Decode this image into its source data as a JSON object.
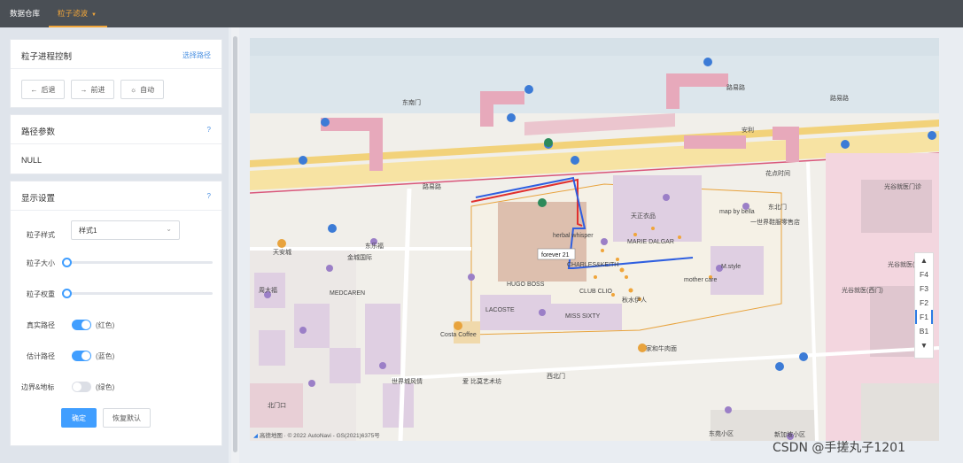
{
  "nav": {
    "item1": "数据仓库",
    "item2": "粒子滤波"
  },
  "control": {
    "title": "粒子进程控制",
    "link": "选择路径",
    "back": "后退",
    "forward": "前进",
    "auto": "自动"
  },
  "path": {
    "title": "路径参数",
    "help": "?",
    "value": "NULL"
  },
  "display": {
    "title": "显示设置",
    "help": "?",
    "style_label": "粒子样式",
    "style_value": "样式1",
    "size_label": "粒子大小",
    "size_value": 0,
    "weight_label": "粒子权重",
    "weight_value": 0,
    "true_label": "真实路径",
    "true_note": "(红色)",
    "true_on": true,
    "est_label": "估计路径",
    "est_note": "(蓝色)",
    "est_on": true,
    "border_label": "边界&地标",
    "border_note": "(绿色)",
    "border_on": false,
    "confirm": "确定",
    "reset": "恢复默认"
  },
  "map": {
    "floors": [
      "F4",
      "F3",
      "F2",
      "F1",
      "B1"
    ],
    "selected_floor": "F1",
    "tooltip": "forever 21",
    "attribution": "高德地图 · © 2022 AutoNavi - GS(2021)6375号",
    "labels": [
      {
        "t": "东南门"
      },
      {
        "t": "路易路"
      },
      {
        "t": "路易路"
      },
      {
        "t": "路易路"
      },
      {
        "t": "安利"
      },
      {
        "t": "花点时间"
      },
      {
        "t": "光谷就医门诊"
      },
      {
        "t": "光谷就医(西门)"
      },
      {
        "t": "光谷就医(西门)"
      },
      {
        "t": "天正衣品"
      },
      {
        "t": "map by bella"
      },
      {
        "t": "一世界鞋服零售店"
      },
      {
        "t": "MARIE DALGAR"
      },
      {
        "t": "herbal whisper"
      },
      {
        "t": "CHARLES&KEITH"
      },
      {
        "t": "HUGO BOSS"
      },
      {
        "t": "CLUB CLIO"
      },
      {
        "t": "LACOSTE"
      },
      {
        "t": "MISS SIXTY"
      },
      {
        "t": "M.style"
      },
      {
        "t": "mother care"
      },
      {
        "t": "秋水伊人"
      },
      {
        "t": "Costa Coffee"
      },
      {
        "t": "家和牛肉面"
      },
      {
        "t": "MEDCAREN"
      },
      {
        "t": "东乐福"
      },
      {
        "t": "天安城"
      },
      {
        "t": "周大福"
      },
      {
        "t": "世界城风情"
      },
      {
        "t": "爱 比莫艺术坊"
      },
      {
        "t": "西北门"
      },
      {
        "t": "新加坡小区"
      },
      {
        "t": "东苑小区"
      },
      {
        "t": "金城国际"
      },
      {
        "t": "东北门"
      },
      {
        "t": "北门口"
      }
    ]
  },
  "watermark": "CSDN @手搓丸子1201"
}
